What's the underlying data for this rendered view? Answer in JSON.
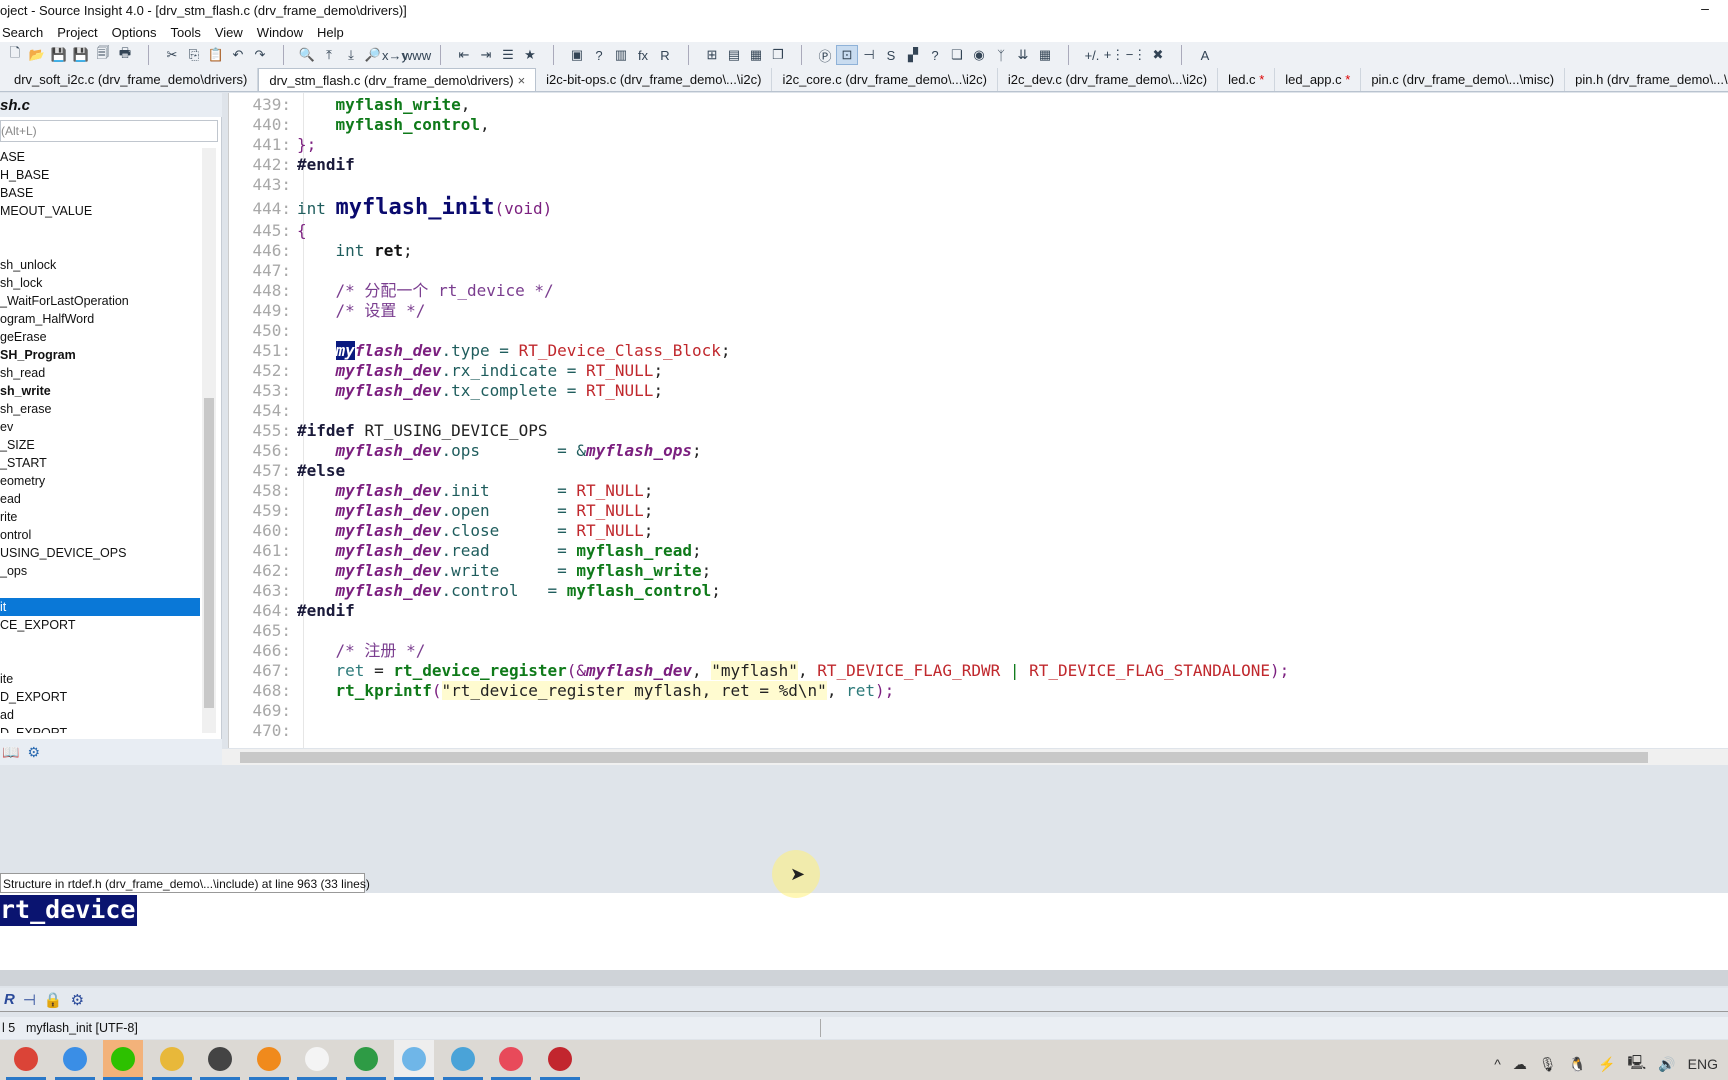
{
  "window": {
    "title": "oject - Source Insight 4.0 - [drv_stm_flash.c (drv_frame_demo\\drivers)]",
    "minimize": "–"
  },
  "menu": [
    "Search",
    "Project",
    "Options",
    "Tools",
    "View",
    "Window",
    "Help"
  ],
  "toolbar": {
    "groups": [
      [
        "new-file",
        "open",
        "save",
        "save-as",
        "save-all",
        "print"
      ],
      [
        "cut",
        "copy",
        "paste",
        "undo",
        "redo"
      ],
      [
        "search",
        "search-backward",
        "search-forward",
        "search-files",
        "replace",
        "browse-web"
      ],
      [
        "jump-back",
        "jump-forward",
        "outline",
        "bookmark"
      ],
      [
        "project-window",
        "symbol-info",
        "library",
        "function-up",
        "relation-R"
      ],
      [
        "layout-1",
        "layout-2",
        "layout-3",
        "layout-4"
      ],
      [
        "p-icon",
        "context-window",
        "relation",
        "symbol",
        "folders",
        "help",
        "clip",
        "globe",
        "bird",
        "merge",
        "grid"
      ],
      [
        "plus-minus",
        "add-line",
        "remove-line",
        "close-x"
      ],
      [
        "font"
      ]
    ],
    "glyphs": {
      "new-file": "🗋",
      "open": "📂",
      "save": "💾",
      "save-as": "💾",
      "save-all": "🗐",
      "print": "🖶",
      "cut": "✂",
      "copy": "⎘",
      "paste": "📋",
      "undo": "↶",
      "redo": "↷",
      "search": "🔍",
      "search-backward": "⤒",
      "search-forward": "⤓",
      "search-files": "🔎",
      "replace": "x→y",
      "browse-web": "www",
      "jump-back": "⇤",
      "jump-forward": "⇥",
      "outline": "☰",
      "bookmark": "★",
      "project-window": "▣",
      "symbol-info": "?",
      "library": "▥",
      "function-up": "fx",
      "relation-R": "R",
      "layout-1": "⊞",
      "layout-2": "▤",
      "layout-3": "▦",
      "layout-4": "❐",
      "p-icon": "Ⓟ",
      "context-window": "⊡",
      "relation": "⊣",
      "symbol": "S",
      "folders": "▞",
      "help": "?",
      "clip": "❏",
      "globe": "◉",
      "bird": "ᛉ",
      "merge": "⇊",
      "grid": "▦",
      "plus-minus": "+/.",
      "add-line": "+⋮",
      "remove-line": "−⋮",
      "close-x": "✖",
      "font": "A"
    },
    "active": "context-window"
  },
  "tabs": [
    {
      "label": "drv_soft_i2c.c (drv_frame_demo\\drivers)",
      "modified": false,
      "active": false
    },
    {
      "label": "drv_stm_flash.c (drv_frame_demo\\drivers)",
      "modified": false,
      "active": true,
      "close": "×"
    },
    {
      "label": "i2c-bit-ops.c (drv_frame_demo\\...\\i2c)",
      "modified": false,
      "active": false
    },
    {
      "label": "i2c_core.c (drv_frame_demo\\...\\i2c)",
      "modified": false,
      "active": false
    },
    {
      "label": "i2c_dev.c (drv_frame_demo\\...\\i2c)",
      "modified": false,
      "active": false
    },
    {
      "label": "led.c",
      "modified": true,
      "active": false
    },
    {
      "label": "led_app.c",
      "modified": true,
      "active": false
    },
    {
      "label": "pin.c (drv_frame_demo\\...\\misc)",
      "modified": false,
      "active": false
    },
    {
      "label": "pin.h (drv_frame_demo\\...\\drivers)",
      "modified": false,
      "active": false
    }
  ],
  "modified_marker": "*",
  "symbol_panel": {
    "title": "sh.c",
    "search_placeholder": "(Alt+L)",
    "items": [
      {
        "t": "ASE"
      },
      {
        "t": "H_BASE"
      },
      {
        "t": "BASE"
      },
      {
        "t": "MEOUT_VALUE"
      },
      {
        "t": ""
      },
      {
        "t": ""
      },
      {
        "t": "sh_unlock"
      },
      {
        "t": "sh_lock"
      },
      {
        "t": "_WaitForLastOperation"
      },
      {
        "t": "ogram_HalfWord"
      },
      {
        "t": "geErase"
      },
      {
        "t": "SH_Program",
        "bold": true
      },
      {
        "t": "sh_read"
      },
      {
        "t": "sh_write",
        "bold": true
      },
      {
        "t": "sh_erase"
      },
      {
        "t": "ev"
      },
      {
        "t": "_SIZE"
      },
      {
        "t": "_START"
      },
      {
        "t": "eometry"
      },
      {
        "t": "ead"
      },
      {
        "t": "rite"
      },
      {
        "t": "ontrol"
      },
      {
        "t": "USING_DEVICE_OPS"
      },
      {
        "t": "_ops"
      },
      {
        "t": ""
      },
      {
        "t": "it",
        "selected": true
      },
      {
        "t": "CE_EXPORT"
      },
      {
        "t": ""
      },
      {
        "t": ""
      },
      {
        "t": "ite"
      },
      {
        "t": "D_EXPORT"
      },
      {
        "t": "ad"
      },
      {
        "t": "D_EXPORT"
      }
    ]
  },
  "code": [
    {
      "n": "439:",
      "tok": [
        [
          "    ",
          "plain"
        ],
        [
          "myflash_write",
          "fn"
        ],
        [
          ",",
          "plain"
        ]
      ]
    },
    {
      "n": "440:",
      "tok": [
        [
          "    ",
          "plain"
        ],
        [
          "myflash_control",
          "fn"
        ],
        [
          ",",
          "plain"
        ]
      ]
    },
    {
      "n": "441:",
      "tok": [
        [
          "};",
          "pn"
        ]
      ]
    },
    {
      "n": "442:",
      "tok": [
        [
          "#endif",
          "pp"
        ]
      ]
    },
    {
      "n": "443:",
      "tok": []
    },
    {
      "n": "444:",
      "big": true,
      "tok": [
        [
          "int ",
          "kw"
        ],
        [
          "myflash_init",
          "def"
        ],
        [
          "(void)",
          "pn"
        ]
      ]
    },
    {
      "n": "445:",
      "tok": [
        [
          "{",
          "pn"
        ]
      ]
    },
    {
      "n": "446:",
      "tok": [
        [
          "    ",
          "plain"
        ],
        [
          "int ",
          "kw"
        ],
        [
          "ret",
          "bold"
        ],
        [
          ";",
          "plain"
        ]
      ]
    },
    {
      "n": "447:",
      "tok": []
    },
    {
      "n": "448:",
      "tok": [
        [
          "    ",
          "plain"
        ],
        [
          "/* 分配一个 rt_device */",
          "cm"
        ]
      ]
    },
    {
      "n": "449:",
      "tok": [
        [
          "    ",
          "plain"
        ],
        [
          "/* 设置 */",
          "cm"
        ]
      ]
    },
    {
      "n": "450:",
      "tok": []
    },
    {
      "n": "451:",
      "tok": [
        [
          "    ",
          "plain"
        ],
        [
          "my",
          "sel"
        ],
        [
          "flash_dev",
          "mem"
        ],
        [
          ".type = ",
          "kw"
        ],
        [
          "RT_Device_Class_Block",
          "const"
        ],
        [
          ";",
          "plain"
        ]
      ]
    },
    {
      "n": "452:",
      "tok": [
        [
          "    ",
          "plain"
        ],
        [
          "myflash_dev",
          "mem"
        ],
        [
          ".rx_indicate = ",
          "kw"
        ],
        [
          "RT_NULL",
          "const"
        ],
        [
          ";",
          "plain"
        ]
      ]
    },
    {
      "n": "453:",
      "tok": [
        [
          "    ",
          "plain"
        ],
        [
          "myflash_dev",
          "mem"
        ],
        [
          ".tx_complete = ",
          "kw"
        ],
        [
          "RT_NULL",
          "const"
        ],
        [
          ";",
          "plain"
        ]
      ]
    },
    {
      "n": "454:",
      "tok": []
    },
    {
      "n": "455:",
      "tok": [
        [
          "#ifdef ",
          "pp"
        ],
        [
          "RT_USING_DEVICE_OPS",
          "plain"
        ]
      ]
    },
    {
      "n": "456:",
      "tok": [
        [
          "    ",
          "plain"
        ],
        [
          "myflash_dev",
          "mem"
        ],
        [
          ".ops        = &",
          "kw"
        ],
        [
          "myflash_ops",
          "mem"
        ],
        [
          ";",
          "plain"
        ]
      ]
    },
    {
      "n": "457:",
      "tok": [
        [
          "#else",
          "pp"
        ]
      ]
    },
    {
      "n": "458:",
      "tok": [
        [
          "    ",
          "plain"
        ],
        [
          "myflash_dev",
          "mem"
        ],
        [
          ".init       = ",
          "kw"
        ],
        [
          "RT_NULL",
          "const"
        ],
        [
          ";",
          "plain"
        ]
      ]
    },
    {
      "n": "459:",
      "tok": [
        [
          "    ",
          "plain"
        ],
        [
          "myflash_dev",
          "mem"
        ],
        [
          ".open       = ",
          "kw"
        ],
        [
          "RT_NULL",
          "const"
        ],
        [
          ";",
          "plain"
        ]
      ]
    },
    {
      "n": "460:",
      "tok": [
        [
          "    ",
          "plain"
        ],
        [
          "myflash_dev",
          "mem"
        ],
        [
          ".close      = ",
          "kw"
        ],
        [
          "RT_NULL",
          "const"
        ],
        [
          ";",
          "plain"
        ]
      ]
    },
    {
      "n": "461:",
      "tok": [
        [
          "    ",
          "plain"
        ],
        [
          "myflash_dev",
          "mem"
        ],
        [
          ".read       = ",
          "kw"
        ],
        [
          "myflash_read",
          "fn"
        ],
        [
          ";",
          "plain"
        ]
      ]
    },
    {
      "n": "462:",
      "tok": [
        [
          "    ",
          "plain"
        ],
        [
          "myflash_dev",
          "mem"
        ],
        [
          ".write      = ",
          "kw"
        ],
        [
          "myflash_write",
          "fn"
        ],
        [
          ";",
          "plain"
        ]
      ]
    },
    {
      "n": "463:",
      "tok": [
        [
          "    ",
          "plain"
        ],
        [
          "myflash_dev",
          "mem"
        ],
        [
          ".control   = ",
          "kw"
        ],
        [
          "myflash_control",
          "fn"
        ],
        [
          ";",
          "plain"
        ]
      ]
    },
    {
      "n": "464:",
      "tok": [
        [
          "#endif",
          "pp"
        ]
      ]
    },
    {
      "n": "465:",
      "tok": []
    },
    {
      "n": "466:",
      "tok": [
        [
          "    ",
          "plain"
        ],
        [
          "/* 注册 */",
          "cm"
        ]
      ]
    },
    {
      "n": "467:",
      "tok": [
        [
          "    ",
          "plain"
        ],
        [
          "ret",
          "var"
        ],
        [
          " = ",
          "plain"
        ],
        [
          "rt_device_register",
          "fn"
        ],
        [
          "(&",
          "pn"
        ],
        [
          "myflash_dev",
          "mem"
        ],
        [
          ", ",
          "plain"
        ],
        [
          "\"myflash\"",
          "str"
        ],
        [
          ", ",
          "plain"
        ],
        [
          "RT_DEVICE_FLAG_RDWR",
          "const"
        ],
        [
          " | ",
          "bar"
        ],
        [
          "RT_DEVICE_FLAG_STANDALONE",
          "const"
        ],
        [
          ");",
          "pn"
        ]
      ]
    },
    {
      "n": "468:",
      "tok": [
        [
          "    ",
          "plain"
        ],
        [
          "rt_kprintf",
          "fn"
        ],
        [
          "(",
          "pn"
        ],
        [
          "\"rt_device_register myflash, ret = %d\\n\"",
          "str"
        ],
        [
          ", ",
          "plain"
        ],
        [
          "ret",
          "var"
        ],
        [
          ");",
          "pn"
        ]
      ]
    },
    {
      "n": "469:",
      "tok": []
    },
    {
      "n": "470:",
      "tok": []
    }
  ],
  "context": {
    "title": "Structure in rtdef.h (drv_frame_demo\\...\\include) at line 963 (33 lines)",
    "symbol": "rt_device"
  },
  "status": {
    "line": "l 5",
    "function": "myflash_init [UTF-8]"
  },
  "taskbar": {
    "apps": [
      {
        "name": "chrome",
        "color": "#db4437"
      },
      {
        "name": "search-app",
        "color": "#3a8ee6"
      },
      {
        "name": "wechat",
        "color": "#2dc100",
        "hl": true
      },
      {
        "name": "file-explorer",
        "color": "#e8b83a"
      },
      {
        "name": "terminal-app",
        "color": "#444"
      },
      {
        "name": "magnifier",
        "color": "#f08a1c"
      },
      {
        "name": "typora",
        "color": "#f4f4f4"
      },
      {
        "name": "green-app",
        "color": "#2e9b45"
      },
      {
        "name": "source-insight",
        "color": "#6fb6e8",
        "act": true
      },
      {
        "name": "anime-app",
        "color": "#4aa3d8"
      },
      {
        "name": "recorder",
        "color": "#e84a5a"
      },
      {
        "name": "game-app",
        "color": "#c2262e"
      }
    ],
    "tray": {
      "chevron": "^",
      "cloud": "☁",
      "mic": "🎙",
      "qq": "🐧",
      "power": "⚡",
      "network": "🖳",
      "volume": "🔊",
      "lang": "ENG"
    }
  },
  "accent": "#0a78d7"
}
